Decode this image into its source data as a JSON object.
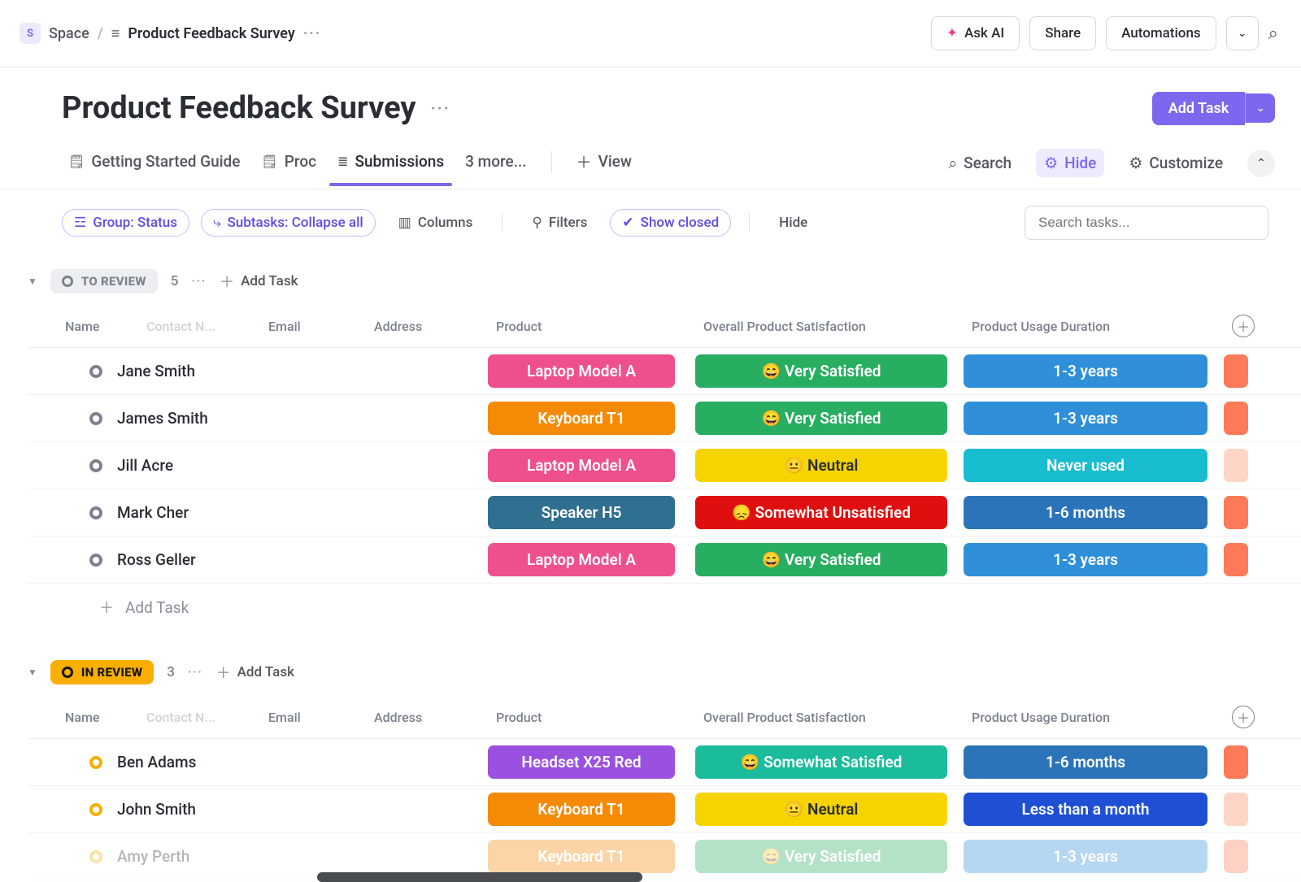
{
  "breadcrumb": {
    "space_initial": "S",
    "space": "Space",
    "separator": "/",
    "page": "Product Feedback Survey"
  },
  "top_actions": {
    "ask_ai": "Ask AI",
    "share": "Share",
    "automations": "Automations"
  },
  "page": {
    "title": "Product Feedback Survey",
    "add_task": "Add Task"
  },
  "tabs": {
    "getting_started": "Getting Started Guide",
    "proc": "Proc",
    "submissions": "Submissions",
    "more": "3 more...",
    "view": "View"
  },
  "tabs_right": {
    "search": "Search",
    "hide": "Hide",
    "customize": "Customize"
  },
  "toolbar": {
    "group": "Group: Status",
    "subtasks": "Subtasks: Collapse all",
    "columns": "Columns",
    "filters": "Filters",
    "show_closed": "Show closed",
    "hide": "Hide",
    "search_placeholder": "Search tasks..."
  },
  "columns": {
    "name": "Name",
    "contact": "Contact N...",
    "email": "Email",
    "address": "Address",
    "product": "Product",
    "satisfaction": "Overall Product Satisfaction",
    "duration": "Product Usage Duration"
  },
  "groups": [
    {
      "key": "to_review",
      "label": "TO REVIEW",
      "count": "5",
      "style": "grey",
      "add_task": "Add Task",
      "rows": [
        {
          "name": "Jane Smith",
          "dot": "grey",
          "product": "Laptop Model A",
          "product_c": "c-pink",
          "sat": "😄 Very Satisfied",
          "sat_c": "c-green",
          "dur": "1-3 years",
          "dur_c": "c-blue",
          "crumb_c": "c-salmon"
        },
        {
          "name": "James Smith",
          "dot": "grey",
          "product": "Keyboard T1",
          "product_c": "c-orange",
          "sat": "😄 Very Satisfied",
          "sat_c": "c-green",
          "dur": "1-3 years",
          "dur_c": "c-blue",
          "crumb_c": "c-salmon"
        },
        {
          "name": "Jill Acre",
          "dot": "grey",
          "product": "Laptop Model A",
          "product_c": "c-pink",
          "sat": "😐 Neutral",
          "sat_c": "c-yellow",
          "dur": "Never used",
          "dur_c": "c-cyan",
          "crumb_c": "c-salmon-lt"
        },
        {
          "name": "Mark Cher",
          "dot": "grey",
          "product": "Speaker H5",
          "product_c": "c-teal-dark",
          "sat": "😞 Somewhat Unsatisfied",
          "sat_c": "c-red",
          "dur": "1-6 months",
          "dur_c": "c-blue2",
          "crumb_c": "c-salmon"
        },
        {
          "name": "Ross Geller",
          "dot": "grey",
          "product": "Laptop Model A",
          "product_c": "c-pink",
          "sat": "😄 Very Satisfied",
          "sat_c": "c-green",
          "dur": "1-3 years",
          "dur_c": "c-blue",
          "crumb_c": "c-salmon"
        }
      ],
      "footer_add": "Add Task"
    },
    {
      "key": "in_review",
      "label": "IN REVIEW",
      "count": "3",
      "style": "orange",
      "add_task": "Add Task",
      "rows": [
        {
          "name": "Ben Adams",
          "dot": "orange",
          "product": "Headset X25 Red",
          "product_c": "c-purple",
          "sat": "😄 Somewhat Satisfied",
          "sat_c": "c-teal",
          "dur": "1-6 months",
          "dur_c": "c-blue2",
          "crumb_c": "c-salmon"
        },
        {
          "name": "John Smith",
          "dot": "orange",
          "product": "Keyboard T1",
          "product_c": "c-orange",
          "sat": "😐 Neutral",
          "sat_c": "c-yellow",
          "dur": "Less than a month",
          "dur_c": "c-bluedeep",
          "crumb_c": "c-salmon-lt"
        },
        {
          "name": "Amy Perth",
          "dot": "orange",
          "product": "Keyboard T1",
          "product_c": "c-orange",
          "sat": "😄 Very Satisfied",
          "sat_c": "c-green",
          "dur": "1-3 years",
          "dur_c": "c-blue",
          "crumb_c": "c-salmon",
          "faded": true
        }
      ]
    }
  ]
}
